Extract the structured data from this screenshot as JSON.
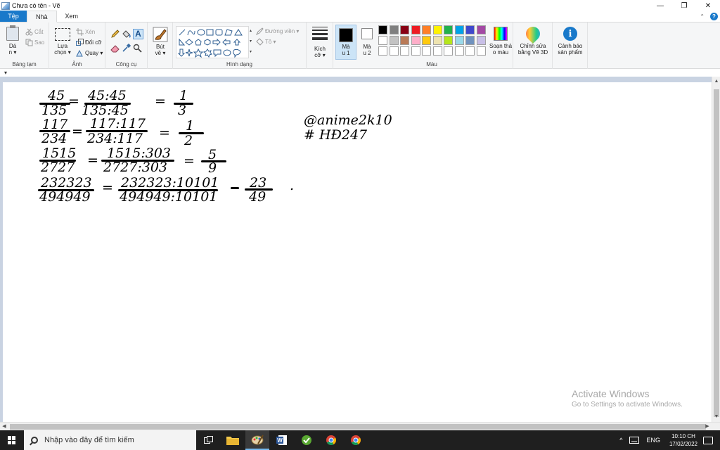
{
  "window": {
    "title": "Chưa có tên - Vẽ",
    "minimize": "—",
    "restore": "❐",
    "close": "✕"
  },
  "tabs": [
    {
      "label": "Tệp"
    },
    {
      "label": "Nhà"
    },
    {
      "label": "Xem"
    }
  ],
  "help": "?",
  "ribbon": {
    "clipboard": {
      "label": "Bảng tạm",
      "paste": "Dá\nn ▾",
      "cut": "Cắt",
      "copy": "Sao"
    },
    "image": {
      "label": "Ảnh",
      "select": "Lựa\nchọn ▾",
      "crop": "Xén",
      "resize": "Đổi cỡ",
      "rotate": "Quay ▾"
    },
    "tools": {
      "label": "Công cụ",
      "text_tool": "A"
    },
    "brushes": {
      "label": "Bút\nvẽ ▾"
    },
    "shapes": {
      "label": "Hình dạng",
      "outline": "Đường viền ▾",
      "fill": "Tô ▾"
    },
    "size": {
      "label": "Kích\ncỡ ▾"
    },
    "color1": {
      "label": "Mà\nu 1",
      "value": "#000000"
    },
    "color2": {
      "label": "Mà\nu 2",
      "value": "#ffffff"
    },
    "colors": {
      "label": "Màu",
      "row1": [
        "#000000",
        "#7f7f7f",
        "#880015",
        "#ed1c24",
        "#ff7f27",
        "#fff200",
        "#22b14c",
        "#00a2e8",
        "#3f48cc",
        "#a349a4"
      ],
      "row2": [
        "#ffffff",
        "#c3c3c3",
        "#b97a57",
        "#ffaec9",
        "#ffc90e",
        "#efe4b0",
        "#b5e61d",
        "#99d9ea",
        "#7092be",
        "#c8bfe7"
      ],
      "row3": [
        "#ffffff",
        "#ffffff",
        "#ffffff",
        "#ffffff",
        "#ffffff",
        "#ffffff",
        "#ffffff",
        "#ffffff",
        "#ffffff",
        "#ffffff"
      ]
    },
    "edit_colors": "Soạn thả\no màu",
    "paint3d": "Chỉnh sửa\nbằng Vẽ 3D",
    "product_alert": "Cảnh báo\nsản phẩm"
  },
  "qat": "▾",
  "canvas": {
    "lines": [
      {
        "num": "45",
        "den": "135",
        "mid_num": "45:45",
        "mid_den": "135:45",
        "res_num": "1",
        "res_den": "3"
      },
      {
        "num": "117",
        "den": "234",
        "mid_num": "117:117",
        "mid_den": "234:117",
        "res_num": "1",
        "res_den": "2"
      },
      {
        "num": "1515",
        "den": "2727",
        "mid_num": "1515:303",
        "mid_den": "2727:303",
        "res_num": "5",
        "res_den": "9"
      },
      {
        "num": "232323",
        "den": "494949",
        "mid_num": "232323:10101",
        "mid_den": "494949:10101",
        "res_num": "23",
        "res_den": "49"
      }
    ],
    "eq": "=",
    "tag1": "@anime2k10",
    "tag2": "# HĐ247",
    "dot": "."
  },
  "watermark": {
    "line1": "Activate Windows",
    "line2": "Go to Settings to activate Windows."
  },
  "taskbar": {
    "search_placeholder": "Nhập vào đây để tìm kiếm",
    "tray_up": "^",
    "lang": "ENG",
    "time": "10:10 CH",
    "date": "17/02/2022"
  }
}
